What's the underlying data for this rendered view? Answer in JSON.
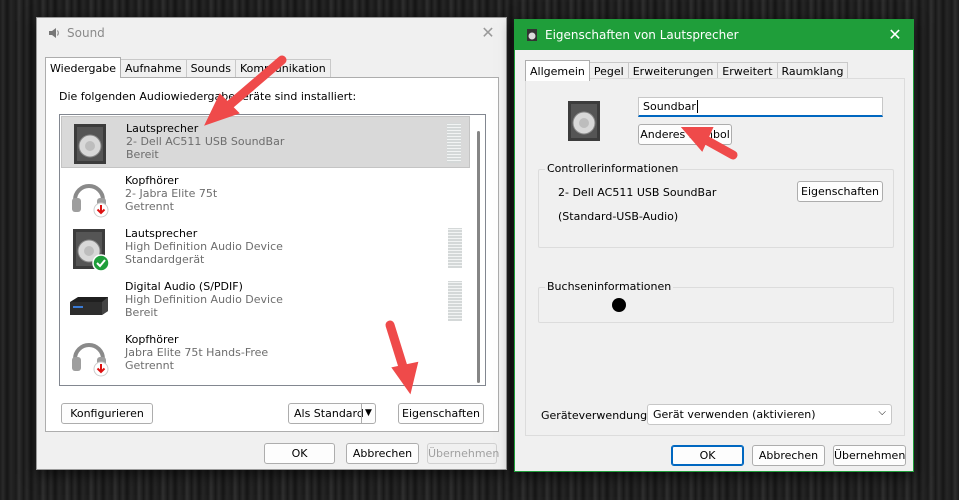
{
  "sound_window": {
    "title": "Sound",
    "tabs": [
      "Wiedergabe",
      "Aufnahme",
      "Sounds",
      "Kommunikation"
    ],
    "active_tab": 0,
    "intro_text": "Die folgenden Audiowiedergabegeräte sind installiert:",
    "devices": [
      {
        "name": "Lautsprecher",
        "line2": "2- Dell AC511 USB SoundBar",
        "status": "Bereit",
        "icon": "speaker-icon",
        "selected": true,
        "meter": true
      },
      {
        "name": "Kopfhörer",
        "line2": "2- Jabra Elite 75t",
        "status": "Getrennt",
        "icon": "headphones-disconnected-icon",
        "selected": false,
        "meter": false
      },
      {
        "name": "Lautsprecher",
        "line2": "High Definition Audio Device",
        "status": "Standardgerät",
        "icon": "speaker-default-icon",
        "selected": false,
        "meter": true
      },
      {
        "name": "Digital Audio (S/PDIF)",
        "line2": "High Definition Audio Device",
        "status": "Bereit",
        "icon": "spdif-device-icon",
        "selected": false,
        "meter": true
      },
      {
        "name": "Kopfhörer",
        "line2": "Jabra Elite 75t Hands-Free",
        "status": "Getrennt",
        "icon": "headphones-disconnected-icon",
        "selected": false,
        "meter": false
      }
    ],
    "buttons": {
      "configure": "Konfigurieren",
      "set_default": "Als Standard",
      "properties": "Eigenschaften",
      "ok": "OK",
      "cancel": "Abbrechen",
      "apply": "Übernehmen"
    }
  },
  "props_window": {
    "title": "Eigenschaften von Lautsprecher",
    "titlebar_color": "#1f9e3a",
    "tabs": [
      "Allgemein",
      "Pegel",
      "Erweiterungen",
      "Erweitert",
      "Raumklang"
    ],
    "active_tab": 0,
    "name_value": "Soundbar",
    "change_icon_label": "Anderes Symbol",
    "controller_group_label": "Controllerinformationen",
    "controller_name": "2- Dell AC511 USB SoundBar",
    "controller_properties_label": "Eigenschaften",
    "controller_driver": "(Standard-USB-Audio)",
    "jack_group_label": "Buchseninformationen",
    "device_usage_label": "Geräteverwendung:",
    "device_usage_value": "Gerät verwenden (aktivieren)",
    "buttons": {
      "ok": "OK",
      "cancel": "Abbrechen",
      "apply": "Übernehmen"
    }
  },
  "annotation_color": "#ef4a4a"
}
